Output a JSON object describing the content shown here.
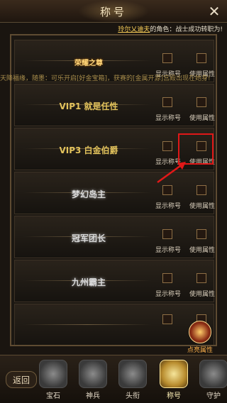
{
  "window": {
    "title": "称号"
  },
  "notice": {
    "player": "玲尔乂迪夫",
    "message": "的角色：战士成功转职为!"
  },
  "ticker": {
    "text": "天降福缘，随墨：可乐开启[好金宝箱]，获赛的[金属开源]宫殿出现在她身!"
  },
  "checkbox_labels": {
    "show": "显示称号",
    "use": "使用属性"
  },
  "titles": [
    {
      "name": "荣耀之尊",
      "style": "gold"
    },
    {
      "name": "VIP1 就是任性",
      "style": "vip"
    },
    {
      "name": "VIP3 白金伯爵",
      "style": "vip"
    },
    {
      "name": "梦幻岛主",
      "style": "silver"
    },
    {
      "name": "冠军团长",
      "style": "silver"
    },
    {
      "name": "九州霸主",
      "style": "silver"
    }
  ],
  "activate": {
    "label": "点亮属性"
  },
  "tabbar": {
    "back_label": "返回",
    "tabs": [
      {
        "label": "宝石"
      },
      {
        "label": "神兵"
      },
      {
        "label": "头衔"
      },
      {
        "label": "称号"
      },
      {
        "label": "守护"
      }
    ],
    "active_index": 3
  },
  "colors": {
    "highlight": "#e01818",
    "accent": "#ffd35a"
  }
}
